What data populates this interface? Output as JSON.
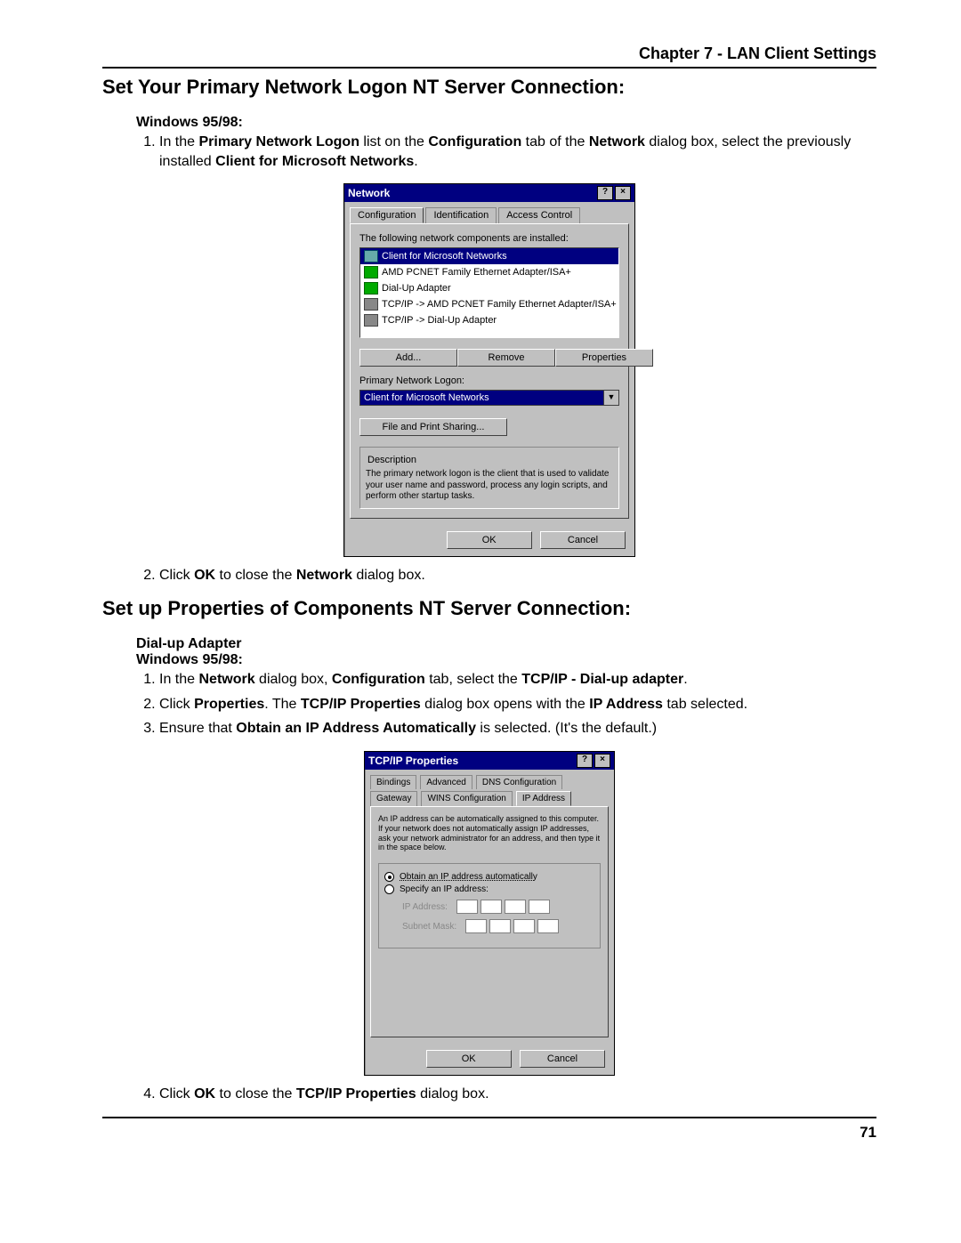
{
  "chapter_header": "Chapter 7 - LAN Client Settings",
  "section1": {
    "title": "Set Your Primary Network Logon NT Server Connection:",
    "sub": "Windows 95/98:",
    "step1_a": "In the ",
    "step1_b": "Primary Network Logon",
    "step1_c": " list on the ",
    "step1_d": "Configuration",
    "step1_e": " tab of the ",
    "step1_f": "Network",
    "step1_g": " dialog box, select the previously installed ",
    "step1_h": "Client for Microsoft Networks",
    "step1_i": ".",
    "step2_a": "Click ",
    "step2_b": "OK",
    "step2_c": " to close the ",
    "step2_d": "Network",
    "step2_e": " dialog box."
  },
  "network_dialog": {
    "title": "Network",
    "help": "?",
    "close": "×",
    "tabs": {
      "config": "Configuration",
      "ident": "Identification",
      "access": "Access Control"
    },
    "components_label": "The following network components are installed:",
    "items": {
      "i0": "Client for Microsoft Networks",
      "i1": "AMD PCNET Family Ethernet Adapter/ISA+",
      "i2": "Dial-Up Adapter",
      "i3": "TCP/IP -> AMD PCNET Family Ethernet Adapter/ISA+",
      "i4": "TCP/IP -> Dial-Up Adapter"
    },
    "btns": {
      "add": "Add...",
      "remove": "Remove",
      "props": "Properties"
    },
    "pnl_label": "Primary Network Logon:",
    "pnl_value": "Client for Microsoft Networks",
    "fps": "File and Print Sharing...",
    "desc_label": "Description",
    "desc_text": "The primary network logon is the client that is used to validate your user name and password, process any login scripts, and perform other startup tasks.",
    "ok": "OK",
    "cancel": "Cancel"
  },
  "section2": {
    "title": "Set up Properties of Components NT Server Connection:",
    "sub1": "Dial-up Adapter",
    "sub2": "Windows 95/98:",
    "step1_a": "In the ",
    "step1_b": "Network",
    "step1_c": " dialog box, ",
    "step1_d": "Configuration",
    "step1_e": " tab, select the ",
    "step1_f": "TCP/IP - Dial-up adapter",
    "step1_g": ".",
    "step2_a": "Click ",
    "step2_b": "Properties",
    "step2_c": ". The ",
    "step2_d": "TCP/IP Properties",
    "step2_e": " dialog box opens with the  ",
    "step2_f": "IP Address",
    "step2_g": " tab selected.",
    "step3_a": "Ensure that ",
    "step3_b": "Obtain an IP Address Automatically",
    "step3_c": " is selected. (It's the default.)",
    "step4_a": "Click ",
    "step4_b": "OK",
    "step4_c": " to close the ",
    "step4_d": "TCP/IP Properties",
    "step4_e": " dialog box."
  },
  "tcpip_dialog": {
    "title": "TCP/IP Properties",
    "help": "?",
    "close": "×",
    "tabs": {
      "bind": "Bindings",
      "adv": "Advanced",
      "dns": "DNS Configuration",
      "gw": "Gateway",
      "wins": "WINS Configuration",
      "ip": "IP Address"
    },
    "intro": "An IP address can be automatically assigned to this computer. If your network does not automatically assign IP addresses, ask your network administrator for an address, and then type it in the space below.",
    "opt_auto": "Obtain an IP address automatically",
    "opt_spec": "Specify an IP address:",
    "ip_label": "IP Address:",
    "mask_label": "Subnet Mask:",
    "ok": "OK",
    "cancel": "Cancel"
  },
  "page_number": "71"
}
